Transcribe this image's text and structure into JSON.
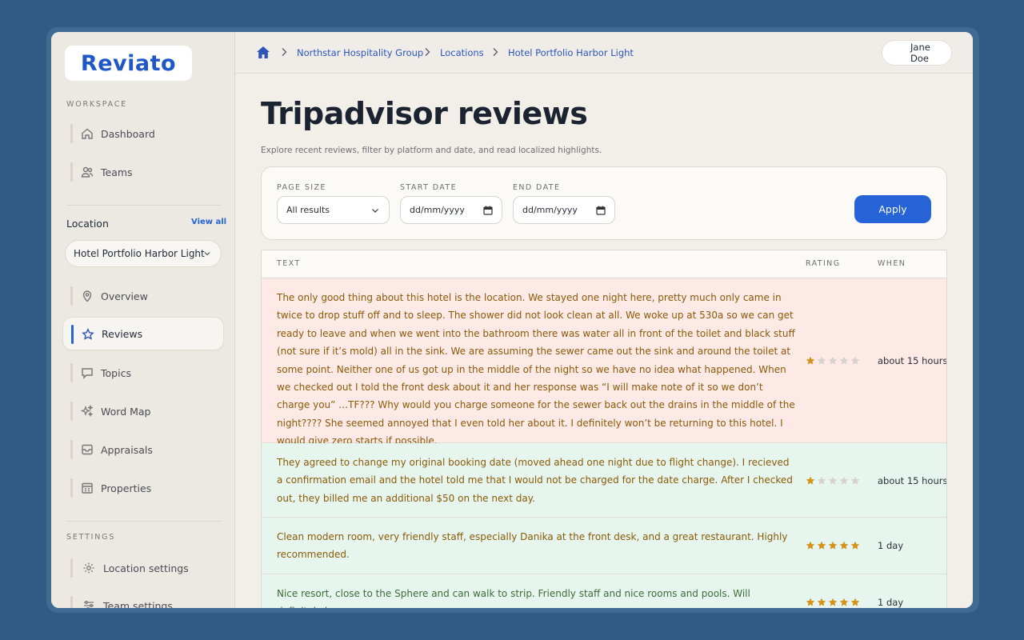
{
  "app": {
    "logo": "Reviato"
  },
  "sidebar": {
    "workspace_label": "WORKSPACE",
    "workspace_items": [
      {
        "label": "Dashboard",
        "icon": "home-icon"
      },
      {
        "label": "Teams",
        "icon": "users-icon"
      }
    ],
    "location_title": "Location",
    "view_all": "View all",
    "location_select": "Hotel Portfolio Harbor Light",
    "location_items": [
      {
        "label": "Overview",
        "icon": "map-pin-icon"
      },
      {
        "label": "Reviews",
        "icon": "star-icon",
        "active": true
      },
      {
        "label": "Topics",
        "icon": "chat-bubble-icon"
      },
      {
        "label": "Word Map",
        "icon": "sparkles-icon"
      },
      {
        "label": "Appraisals",
        "icon": "inbox-icon"
      },
      {
        "label": "Properties",
        "icon": "building-icon"
      }
    ],
    "settings_label": "SETTINGS",
    "settings_items": [
      {
        "label": "Location settings",
        "icon": "gear-icon"
      },
      {
        "label": "Team settings",
        "icon": "sliders-icon"
      }
    ]
  },
  "breadcrumb": {
    "items": [
      "Northstar Hospitality Group",
      "Locations",
      "Hotel Portfolio Harbor Light"
    ]
  },
  "user": {
    "name": "Jane Doe"
  },
  "page": {
    "title": "Tripadvisor reviews",
    "subtitle": "Explore recent reviews, filter by platform and date, and read localized highlights."
  },
  "filters": {
    "page_size_label": "PAGE SIZE",
    "page_size_value": "All results",
    "start_date_label": "START DATE",
    "start_date_value": "dd/mm/yyyy",
    "end_date_label": "END DATE",
    "end_date_value": "dd/mm/yyyy",
    "apply": "Apply"
  },
  "table": {
    "headers": {
      "text": "TEXT",
      "rating": "RATING",
      "when": "WHEN"
    },
    "rows": [
      {
        "text": "The only good thing about this hotel is the location. We stayed one night here, pretty much only came in twice to drop stuff off and to sleep. The shower did not look clean at all. We woke up at 530a so we can get ready to leave and when we went into the bathroom there was water all in front of the toilet and black stuff (not sure if it’s mold) all in the sink. We are assuming the sewer came out the sink and around the toilet at some point. Neither one of us got up in the middle of the night so we have no idea what happened. When we checked out I told the front desk about it and her response was “I will make note of it so we don’t charge you” …TF??? Why would you charge someone for the sewer back out the drains in the middle of the night???? She seemed annoyed that I even told her about it. I definitely won’t be returning to this hotel. I would give zero starts if possible.",
        "rating": 1,
        "when": "about 15 hours",
        "sentiment": "negative"
      },
      {
        "text": "They agreed to change my original booking date (moved ahead one night due to flight change). I recieved a confirmation email and the hotel told me that I would not be charged for the date charge. After I checked out, they billed me an additional $50 on the next day.",
        "rating": 1,
        "when": "about 15 hours",
        "sentiment": "mixed"
      },
      {
        "text": "Clean modern room, very friendly staff, especially Danika at the front desk, and a great restaurant. Highly recommended.",
        "rating": 5,
        "when": "1 day",
        "sentiment": "mixed"
      },
      {
        "text": "Nice resort, close to the Sphere and can walk to strip. Friendly staff and nice rooms and pools. Will definitely be",
        "rating": 5,
        "when": "1 day",
        "sentiment": "positive"
      }
    ]
  },
  "colors": {
    "accent": "#2563d6",
    "negative_row": "#fde9e6",
    "positive_row": "#e6f6ee",
    "star_filled": "#d4941c",
    "star_empty": "#d6d3ce",
    "background": "#2f5a83"
  }
}
